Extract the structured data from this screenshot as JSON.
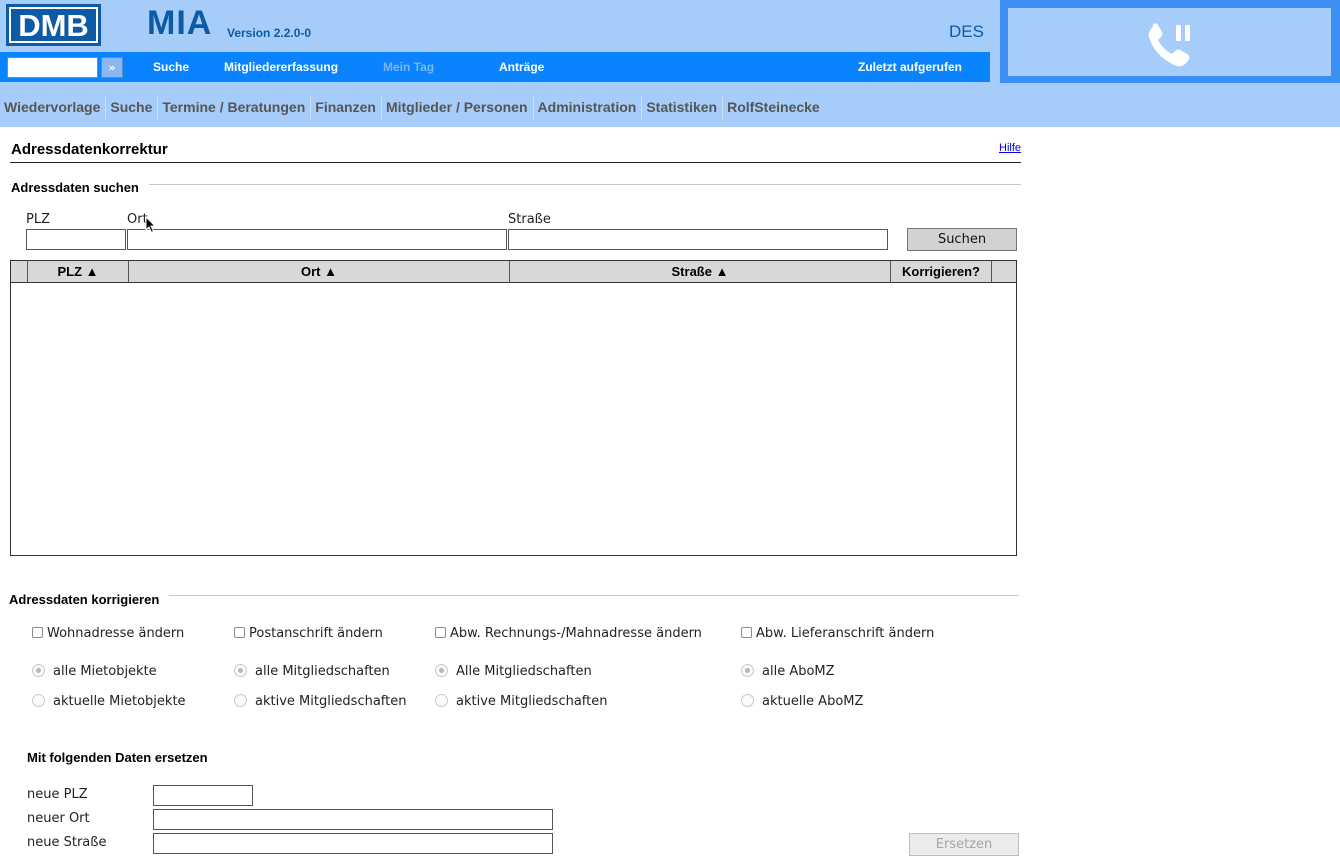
{
  "header": {
    "logo_text": "DMB",
    "app_name": "MIA",
    "app_version": "Version 2.2.0-0",
    "user_code": "DES",
    "phone_icon": "phone-hold-icon"
  },
  "topbar": {
    "quick_search_value": "",
    "quick_go_label": "»",
    "items": [
      {
        "label": "Suche"
      },
      {
        "label": "Mitgliedererfassung"
      },
      {
        "label": "Mein Tag"
      },
      {
        "label": "Anträge"
      },
      {
        "label": "Zuletzt aufgerufen"
      }
    ]
  },
  "mainnav": {
    "items": [
      {
        "label": "Wiedervorlage"
      },
      {
        "label": "Suche"
      },
      {
        "label": "Termine / Beratungen"
      },
      {
        "label": "Finanzen"
      },
      {
        "label": "Mitglieder / Personen"
      },
      {
        "label": "Administration"
      },
      {
        "label": "Statistiken"
      },
      {
        "label": "RolfSteinecke"
      }
    ]
  },
  "page": {
    "title": "Adressdatenkorrektur",
    "help_label": "Hilfe"
  },
  "search": {
    "section_title": "Adressdaten suchen",
    "plz_label": "PLZ",
    "ort_label": "Ort",
    "strasse_label": "Straße",
    "plz_value": "",
    "ort_value": "",
    "strasse_value": "",
    "search_button": "Suchen"
  },
  "results_table": {
    "columns": [
      "PLZ ▲",
      "Ort ▲",
      "Straße ▲",
      "Korrigieren?"
    ],
    "rows": []
  },
  "correct": {
    "section_title": "Adressdaten korrigieren",
    "groups": [
      {
        "checkbox_label": "Wohnadresse ändern",
        "checked": false,
        "radio_all": "alle Mietobjekte",
        "radio_current": "aktuelle Mietobjekte",
        "selected": "all"
      },
      {
        "checkbox_label": "Postanschrift ändern",
        "checked": false,
        "radio_all": "alle Mitgliedschaften",
        "radio_current": "aktive Mitgliedschaften",
        "selected": "all"
      },
      {
        "checkbox_label": "Abw. Rechnungs-/Mahnadresse ändern",
        "checked": false,
        "radio_all": "Alle Mitgliedschaften",
        "radio_current": "aktive Mitgliedschaften",
        "selected": "all"
      },
      {
        "checkbox_label": "Abw. Lieferanschrift ändern",
        "checked": false,
        "radio_all": "alle AboMZ",
        "radio_current": "aktuelle AboMZ",
        "selected": "all"
      }
    ]
  },
  "replace": {
    "title": "Mit folgenden Daten ersetzen",
    "new_plz_label": "neue PLZ",
    "new_ort_label": "neuer Ort",
    "new_strasse_label": "neue Straße",
    "new_plz_value": "",
    "new_ort_value": "",
    "new_strasse_value": "",
    "replace_button": "Ersetzen"
  }
}
